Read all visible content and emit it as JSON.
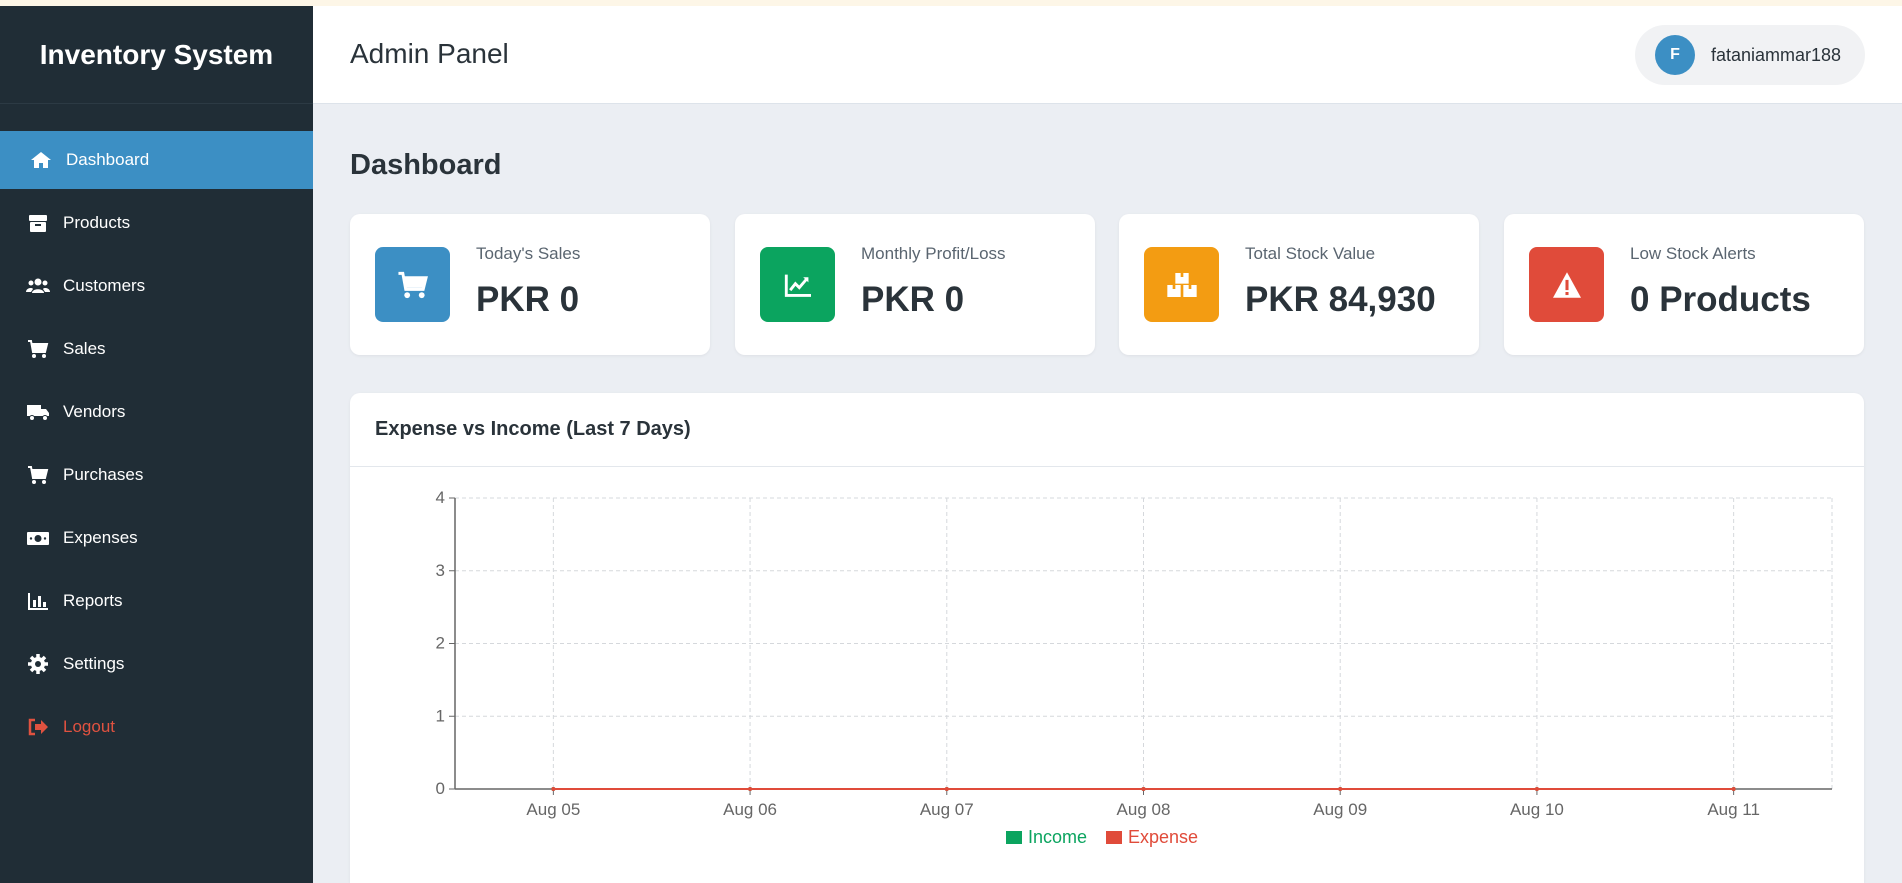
{
  "app": {
    "brand": "Inventory System"
  },
  "sidebar": {
    "items": [
      {
        "label": "Dashboard",
        "icon": "home-icon",
        "active": true
      },
      {
        "label": "Products",
        "icon": "box-icon"
      },
      {
        "label": "Customers",
        "icon": "users-icon"
      },
      {
        "label": "Sales",
        "icon": "cart-icon"
      },
      {
        "label": "Vendors",
        "icon": "truck-icon"
      },
      {
        "label": "Purchases",
        "icon": "cart-icon"
      },
      {
        "label": "Expenses",
        "icon": "money-icon"
      },
      {
        "label": "Reports",
        "icon": "bar-chart-icon"
      },
      {
        "label": "Settings",
        "icon": "gear-icon"
      },
      {
        "label": "Logout",
        "icon": "logout-icon"
      }
    ]
  },
  "header": {
    "title": "Admin Panel",
    "user": {
      "initial": "F",
      "name": "fataniammar188"
    }
  },
  "main": {
    "title": "Dashboard",
    "cards": [
      {
        "label": "Today's Sales",
        "value": "PKR 0",
        "icon": "cart-icon",
        "color": "#3c8fc4"
      },
      {
        "label": "Monthly Profit/Loss",
        "value": "PKR 0",
        "icon": "trend-chart-icon",
        "color": "#0ba45f"
      },
      {
        "label": "Total Stock Value",
        "value": "PKR 84,930",
        "icon": "boxes-icon",
        "color": "#f39c12"
      },
      {
        "label": "Low Stock Alerts",
        "value": "0 Products",
        "icon": "warning-icon",
        "color": "#e04b3a"
      }
    ],
    "chart_title": "Expense vs Income (Last 7 Days)"
  },
  "colors": {
    "sidebar_bg": "#202d36",
    "accent": "#3c8fc4",
    "logout": "#e05240"
  },
  "chart_data": {
    "type": "line",
    "title": "Expense vs Income (Last 7 Days)",
    "categories": [
      "Aug 05",
      "Aug 06",
      "Aug 07",
      "Aug 08",
      "Aug 09",
      "Aug 10",
      "Aug 11"
    ],
    "series": [
      {
        "name": "Income",
        "values": [
          0,
          0,
          0,
          0,
          0,
          0,
          0
        ],
        "color": "#0ba45f"
      },
      {
        "name": "Expense",
        "values": [
          0,
          0,
          0,
          0,
          0,
          0,
          0
        ],
        "color": "#e04b3a"
      }
    ],
    "yticks": [
      "0",
      "1",
      "2",
      "3",
      "4"
    ],
    "ylim": [
      0,
      4
    ],
    "grid": true,
    "legend_position": "bottom"
  }
}
